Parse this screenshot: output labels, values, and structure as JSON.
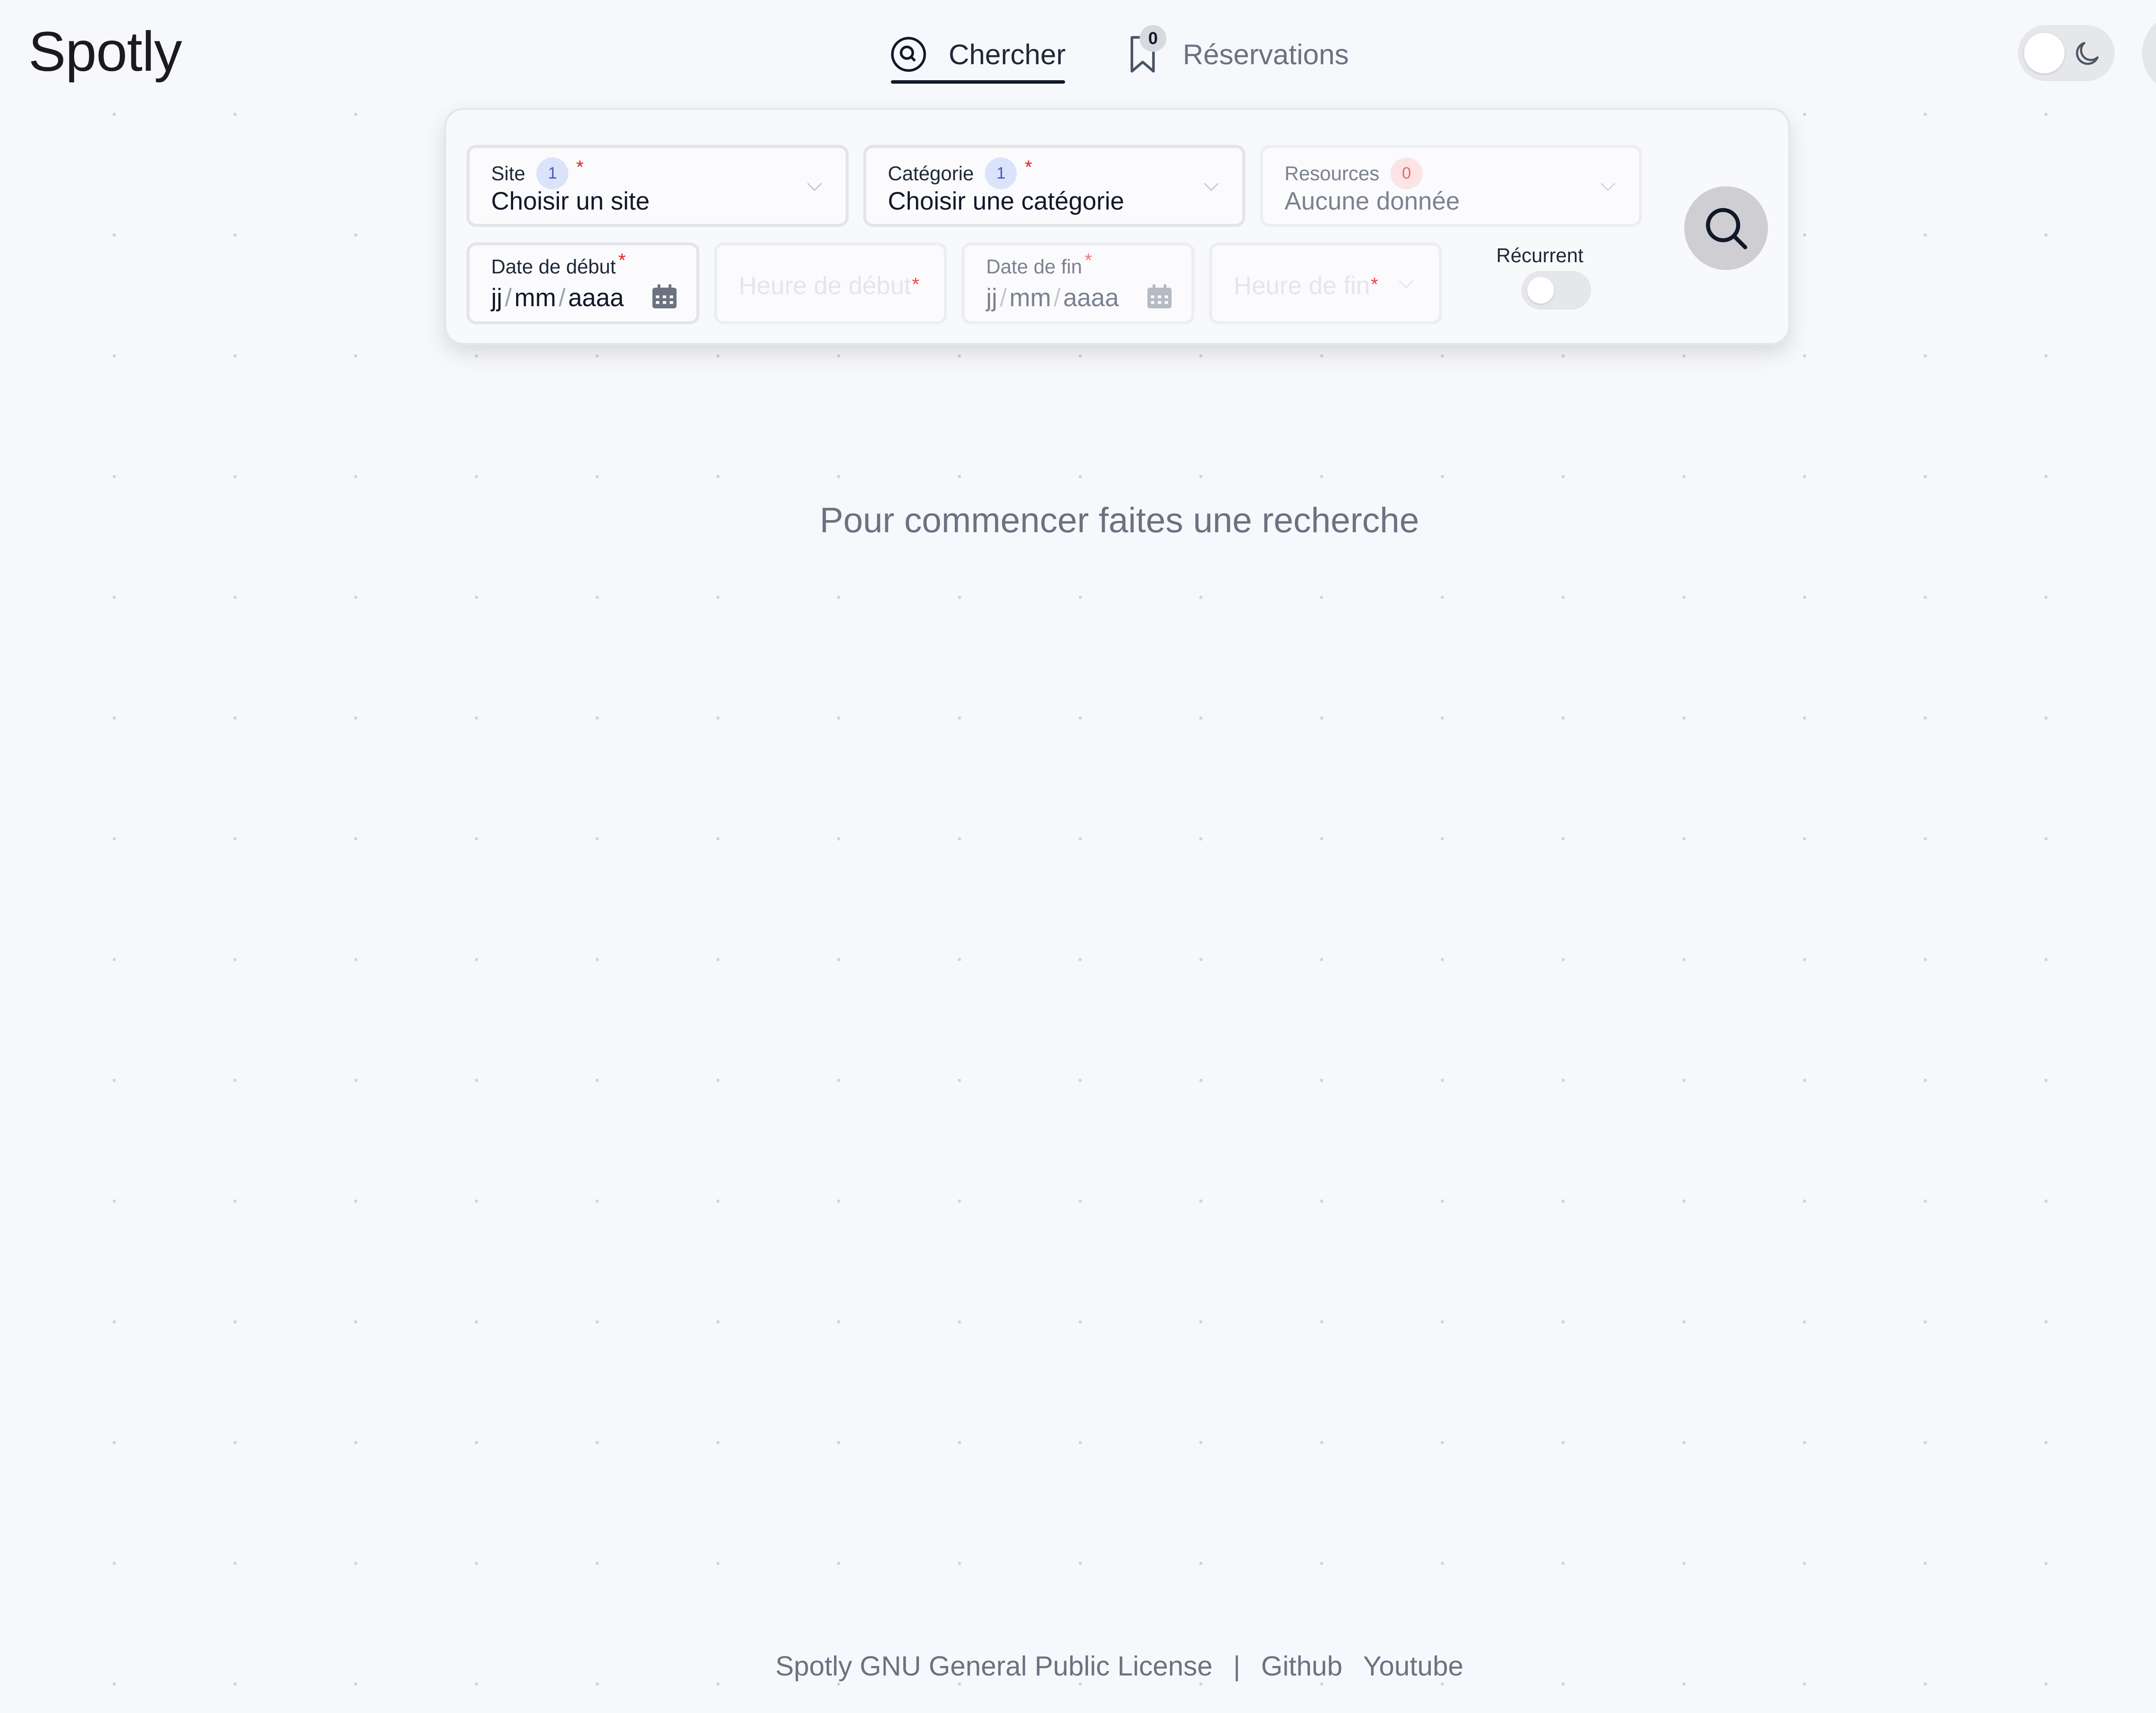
{
  "app": {
    "title": "Spotly"
  },
  "nav": {
    "tabs": [
      {
        "label": "Chercher",
        "icon": "at-search-icon",
        "active": true
      },
      {
        "label": "Réservations",
        "icon": "bookmark-icon",
        "badge": "0",
        "active": false
      }
    ]
  },
  "header": {
    "theme_toggle": {
      "state": "light",
      "icon": "moon-icon"
    },
    "settings_icon": "gear-icon"
  },
  "search_panel": {
    "site": {
      "label": "Site",
      "count": "1",
      "required": "*",
      "value": "Choisir un site"
    },
    "category": {
      "label": "Catégorie",
      "count": "1",
      "required": "*",
      "value": "Choisir une catégorie"
    },
    "resources": {
      "label": "Resources",
      "count": "0",
      "value": "Aucune donnée"
    },
    "start_date": {
      "label": "Date de début",
      "required": "*",
      "day": "jj",
      "month": "mm",
      "year": "aaaa",
      "separator": "/"
    },
    "start_time": {
      "placeholder": "Heure de début",
      "required": "*"
    },
    "end_date": {
      "label": "Date de fin",
      "required": "*",
      "day": "jj",
      "month": "mm",
      "year": "aaaa",
      "separator": "/"
    },
    "end_time": {
      "placeholder": "Heure de fin",
      "required": "*"
    },
    "recurrent": {
      "label": "Récurrent",
      "enabled": false
    },
    "search_button_icon": "search-icon"
  },
  "main": {
    "empty_message": "Pour commencer faites une recherche"
  },
  "footer": {
    "license": "Spotly GNU General Public License",
    "separator": "|",
    "links": [
      "Github",
      "Youtube"
    ]
  },
  "colors": {
    "background": "#f7f8fb",
    "badge_blue_bg": "#dbe3fb",
    "badge_blue_text": "#4856c6",
    "badge_red_bg": "#fbe3e6",
    "badge_red_text": "#e46a76",
    "required": "#dc2626",
    "search_button": "#cfcfd3"
  }
}
